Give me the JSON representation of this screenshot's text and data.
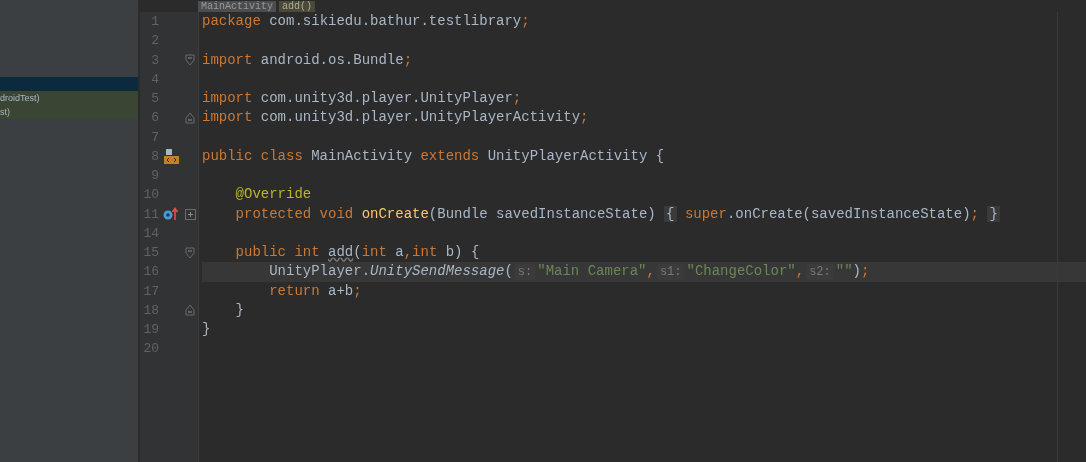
{
  "sidebar": {
    "items": [
      {
        "selected": true
      },
      {
        "label": "droidTest)",
        "selected": false,
        "tinted": true
      },
      {
        "label": "st)",
        "selected": false,
        "tinted": true
      }
    ]
  },
  "breadcrumbs": [
    {
      "label": "MainActivity",
      "kind": "class"
    },
    {
      "label": "add()",
      "kind": "method"
    }
  ],
  "lines": [
    {
      "number": "1",
      "tokens": [
        {
          "kind": "keyword",
          "text": "package "
        },
        {
          "kind": "plain",
          "text": "com.sikiedu.bathur.testlibrary"
        },
        {
          "kind": "keyword",
          "text": ";"
        }
      ]
    },
    {
      "number": "2"
    },
    {
      "number": "3",
      "fold_start": true,
      "tokens": [
        {
          "kind": "keyword",
          "text": "import "
        },
        {
          "kind": "plain",
          "text": "android.os.Bundle"
        },
        {
          "kind": "keyword",
          "text": ";"
        }
      ]
    },
    {
      "number": "4"
    },
    {
      "number": "5",
      "tokens": [
        {
          "kind": "keyword",
          "text": "import "
        },
        {
          "kind": "plain",
          "text": "com.unity3d.player.UnityPlayer"
        },
        {
          "kind": "keyword",
          "text": ";"
        }
      ]
    },
    {
      "number": "6",
      "fold_end": true,
      "tokens": [
        {
          "kind": "keyword",
          "text": "import "
        },
        {
          "kind": "plain",
          "text": "com.unity3d.player.UnityPlayerActivity"
        },
        {
          "kind": "keyword",
          "text": ";"
        }
      ]
    },
    {
      "number": "7"
    },
    {
      "number": "8",
      "class_icon": true,
      "tokens": [
        {
          "kind": "keyword",
          "text": "public class "
        },
        {
          "kind": "plain",
          "text": "MainActivity "
        },
        {
          "kind": "keyword",
          "text": "extends "
        },
        {
          "kind": "plain",
          "text": "UnityPlayerActivity {"
        }
      ]
    },
    {
      "number": "9"
    },
    {
      "number": "10",
      "tokens": [
        {
          "kind": "annotation",
          "text": "    @Override"
        }
      ]
    },
    {
      "number": "11",
      "override_icon": true,
      "collapsed": true,
      "tokens": [
        {
          "kind": "keyword",
          "text": "    protected void "
        },
        {
          "kind": "method",
          "text": "onCreate"
        },
        {
          "kind": "plain",
          "text": "(Bundle savedInstanceState) "
        },
        {
          "kind": "folded",
          "text": "{"
        },
        {
          "kind": "keyword",
          "text": " super"
        },
        {
          "kind": "plain",
          "text": ".onCreate(savedInstanceState)"
        },
        {
          "kind": "keyword",
          "text": "; "
        },
        {
          "kind": "folded",
          "text": "}"
        }
      ]
    },
    {
      "number": "14"
    },
    {
      "number": "15",
      "fold_start": true,
      "tokens": [
        {
          "kind": "keyword",
          "text": "    public int "
        },
        {
          "kind": "unused",
          "text": "add"
        },
        {
          "kind": "plain",
          "text": "("
        },
        {
          "kind": "keyword",
          "text": "int "
        },
        {
          "kind": "plain",
          "text": "a"
        },
        {
          "kind": "keyword",
          "text": ",int "
        },
        {
          "kind": "plain",
          "text": "b) {"
        }
      ]
    },
    {
      "number": "16",
      "current": true,
      "tokens": [
        {
          "kind": "plain",
          "text": "        UnityPlayer."
        },
        {
          "kind": "italic",
          "text": "UnitySendMessage"
        },
        {
          "kind": "plain",
          "text": "("
        },
        {
          "kind": "hint",
          "text": "s:"
        },
        {
          "kind": "string",
          "text": "\"Main Camera\""
        },
        {
          "kind": "keyword",
          "text": ","
        },
        {
          "kind": "hint",
          "text": "s1:"
        },
        {
          "kind": "string",
          "text": "\"ChangeColor\""
        },
        {
          "kind": "keyword",
          "text": ","
        },
        {
          "kind": "hint",
          "text": "s2:"
        },
        {
          "kind": "string",
          "text": "\"\""
        },
        {
          "kind": "plain",
          "text": ")"
        },
        {
          "kind": "keyword",
          "text": ";"
        }
      ]
    },
    {
      "number": "17",
      "tokens": [
        {
          "kind": "keyword",
          "text": "        return "
        },
        {
          "kind": "plain",
          "text": "a+b"
        },
        {
          "kind": "keyword",
          "text": ";"
        }
      ]
    },
    {
      "number": "18",
      "fold_end": true,
      "tokens": [
        {
          "kind": "plain",
          "text": "    }"
        }
      ]
    },
    {
      "number": "19",
      "tokens": [
        {
          "kind": "plain",
          "text": "}"
        }
      ]
    },
    {
      "number": "20"
    }
  ]
}
